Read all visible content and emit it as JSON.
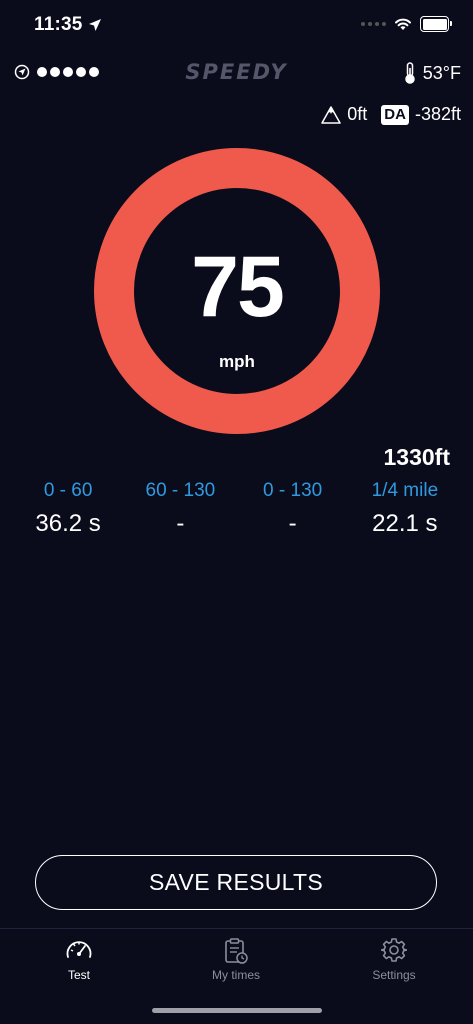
{
  "status_bar": {
    "time": "11:35"
  },
  "header": {
    "app_name": "SPEEDY",
    "temperature": "53°F",
    "altitude": "0ft",
    "density_altitude_badge": "DA",
    "density_altitude": "-382ft",
    "gps_signal_dots": 5
  },
  "gauge": {
    "speed": "75",
    "unit": "mph",
    "ring_color": "#f05a4c"
  },
  "distance": "1330ft",
  "metrics": [
    {
      "label": "0 - 60",
      "value": "36.2 s"
    },
    {
      "label": "60 - 130",
      "value": "-"
    },
    {
      "label": "0 - 130",
      "value": "-"
    },
    {
      "label": "1/4 mile",
      "value": "22.1 s"
    }
  ],
  "save_button": {
    "label": "SAVE RESULTS"
  },
  "tabs": [
    {
      "label": "Test",
      "icon": "speedometer-icon",
      "active": true
    },
    {
      "label": "My times",
      "icon": "clipboard-clock-icon",
      "active": false
    },
    {
      "label": "Settings",
      "icon": "gear-icon",
      "active": false
    }
  ],
  "colors": {
    "background": "#0b0c1b",
    "accent_blue": "#2e9ae0",
    "ring_red": "#f05a4c"
  }
}
